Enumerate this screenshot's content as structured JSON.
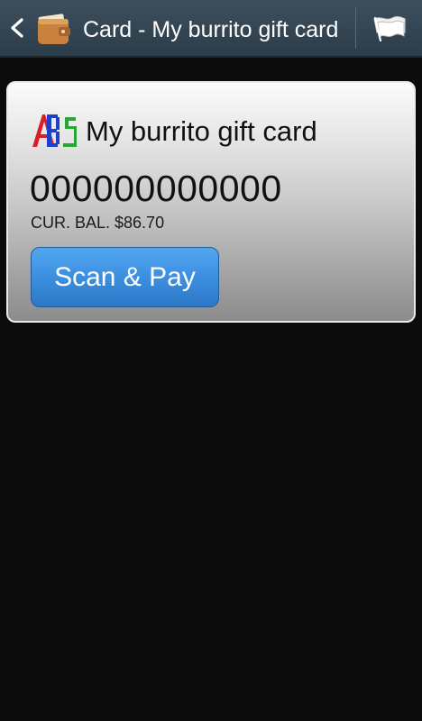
{
  "action_bar": {
    "title": "Card - My burrito gift card",
    "icons": {
      "back": "chevron-left-icon",
      "app": "wallet-icon",
      "overflow": "flag-icon"
    },
    "colors": {
      "background": "#34495a",
      "text": "#ffffff"
    }
  },
  "card": {
    "logo_text": "ABS",
    "name": "My burrito gift card",
    "number": "000000000000",
    "balance_text": "CUR. BAL. $86.70",
    "scan_pay_label": "Scan & Pay",
    "colors": {
      "button": "#3c8fe0",
      "logo_red": "#d81f26",
      "logo_blue": "#1f3fc8",
      "logo_green": "#27a637"
    }
  }
}
